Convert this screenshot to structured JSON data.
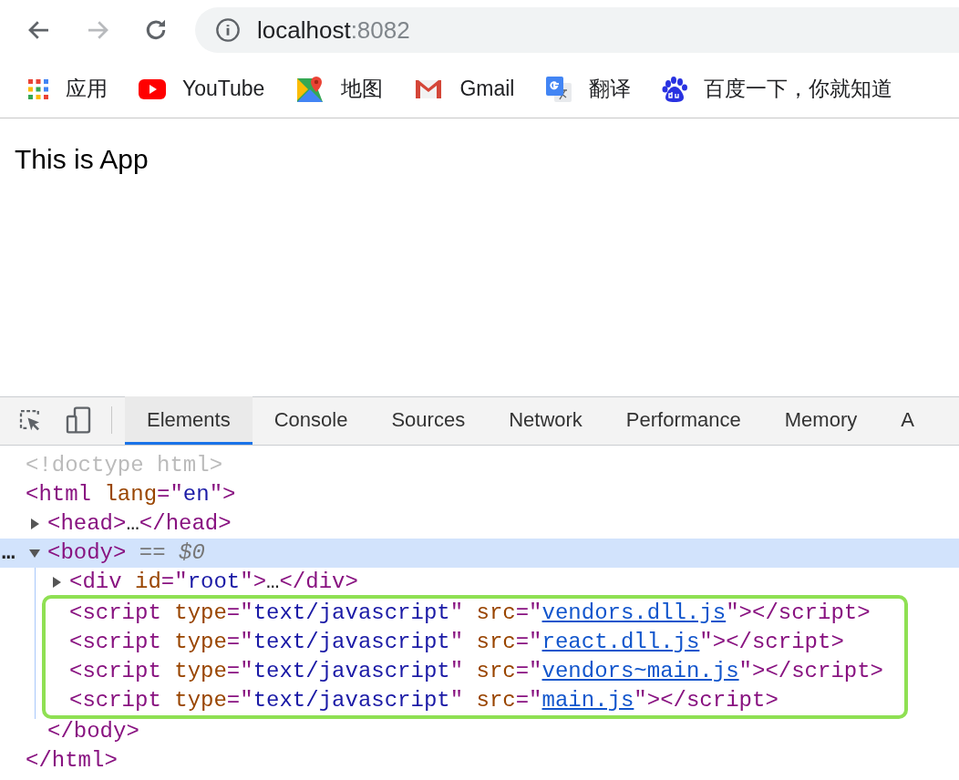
{
  "address_bar": {
    "host": "localhost",
    "port": ":8082"
  },
  "bookmarks": [
    {
      "kind": "apps",
      "label": "应用"
    },
    {
      "kind": "youtube",
      "label": "YouTube"
    },
    {
      "kind": "maps",
      "label": "地图"
    },
    {
      "kind": "gmail",
      "label": "Gmail"
    },
    {
      "kind": "translate",
      "label": "翻译"
    },
    {
      "kind": "baidu",
      "label": "百度一下，你就知道"
    }
  ],
  "page": {
    "heading": "This is App"
  },
  "devtools": {
    "tabs": [
      {
        "label": "Elements",
        "selected": true
      },
      {
        "label": "Console",
        "selected": false
      },
      {
        "label": "Sources",
        "selected": false
      },
      {
        "label": "Network",
        "selected": false
      },
      {
        "label": "Performance",
        "selected": false
      },
      {
        "label": "Memory",
        "selected": false
      },
      {
        "label": "A",
        "selected": false
      }
    ],
    "dom": [
      {
        "parts": [
          {
            "kind": "doctype",
            "text": "<!doctype html>"
          }
        ]
      },
      {
        "parts": [
          {
            "kind": "tag",
            "text": "<html"
          },
          {
            "kind": "attr",
            "text": " lang"
          },
          {
            "kind": "tag",
            "text": "=\""
          },
          {
            "kind": "value",
            "text": "en"
          },
          {
            "kind": "tag",
            "text": "\">"
          }
        ],
        "close": [
          {
            "kind": "tag",
            "text": "</html>"
          }
        ],
        "children": [
          {
            "expanded": false,
            "parts": [
              {
                "kind": "tag",
                "text": "<head>"
              },
              {
                "kind": "plain",
                "text": "…"
              },
              {
                "kind": "tag",
                "text": "</head>"
              }
            ]
          },
          {
            "expanded": true,
            "selected": true,
            "marker": "…",
            "parts": [
              {
                "kind": "tag",
                "text": "<body>"
              },
              {
                "kind": "operator",
                "text": " =="
              },
              {
                "kind": "ref",
                "text": " $0"
              }
            ],
            "close": [
              {
                "kind": "tag",
                "text": "</body>"
              }
            ],
            "children": [
              {
                "expanded": false,
                "parts": [
                  {
                    "kind": "tag",
                    "text": "<div"
                  },
                  {
                    "kind": "attr",
                    "text": " id"
                  },
                  {
                    "kind": "tag",
                    "text": "=\""
                  },
                  {
                    "kind": "value",
                    "text": "root"
                  },
                  {
                    "kind": "tag",
                    "text": "\">"
                  },
                  {
                    "kind": "plain",
                    "text": "…"
                  },
                  {
                    "kind": "tag",
                    "text": "</div>"
                  }
                ]
              },
              {
                "kind": "highlight",
                "color": "#8fe053",
                "children": [
                  {
                    "parts": [
                      {
                        "kind": "tag",
                        "text": "<script"
                      },
                      {
                        "kind": "attr",
                        "text": " type"
                      },
                      {
                        "kind": "tag",
                        "text": "=\""
                      },
                      {
                        "kind": "value",
                        "text": "text/javascript"
                      },
                      {
                        "kind": "tag",
                        "text": "\""
                      },
                      {
                        "kind": "attr",
                        "text": " src"
                      },
                      {
                        "kind": "tag",
                        "text": "=\""
                      },
                      {
                        "kind": "link",
                        "text": "vendors.dll.js"
                      },
                      {
                        "kind": "tag",
                        "text": "\"></script>"
                      }
                    ]
                  },
                  {
                    "parts": [
                      {
                        "kind": "tag",
                        "text": "<script"
                      },
                      {
                        "kind": "attr",
                        "text": " type"
                      },
                      {
                        "kind": "tag",
                        "text": "=\""
                      },
                      {
                        "kind": "value",
                        "text": "text/javascript"
                      },
                      {
                        "kind": "tag",
                        "text": "\""
                      },
                      {
                        "kind": "attr",
                        "text": " src"
                      },
                      {
                        "kind": "tag",
                        "text": "=\""
                      },
                      {
                        "kind": "link",
                        "text": "react.dll.js"
                      },
                      {
                        "kind": "tag",
                        "text": "\"></script>"
                      }
                    ]
                  },
                  {
                    "parts": [
                      {
                        "kind": "tag",
                        "text": "<script"
                      },
                      {
                        "kind": "attr",
                        "text": " type"
                      },
                      {
                        "kind": "tag",
                        "text": "=\""
                      },
                      {
                        "kind": "value",
                        "text": "text/javascript"
                      },
                      {
                        "kind": "tag",
                        "text": "\""
                      },
                      {
                        "kind": "attr",
                        "text": " src"
                      },
                      {
                        "kind": "tag",
                        "text": "=\""
                      },
                      {
                        "kind": "link",
                        "text": "vendors~main.js"
                      },
                      {
                        "kind": "tag",
                        "text": "\"></script>"
                      }
                    ]
                  },
                  {
                    "parts": [
                      {
                        "kind": "tag",
                        "text": "<script"
                      },
                      {
                        "kind": "attr",
                        "text": " type"
                      },
                      {
                        "kind": "tag",
                        "text": "=\""
                      },
                      {
                        "kind": "value",
                        "text": "text/javascript"
                      },
                      {
                        "kind": "tag",
                        "text": "\""
                      },
                      {
                        "kind": "attr",
                        "text": " src"
                      },
                      {
                        "kind": "tag",
                        "text": "=\""
                      },
                      {
                        "kind": "link",
                        "text": "main.js"
                      },
                      {
                        "kind": "tag",
                        "text": "\"></script>"
                      }
                    ]
                  }
                ]
              }
            ]
          }
        ]
      }
    ]
  }
}
